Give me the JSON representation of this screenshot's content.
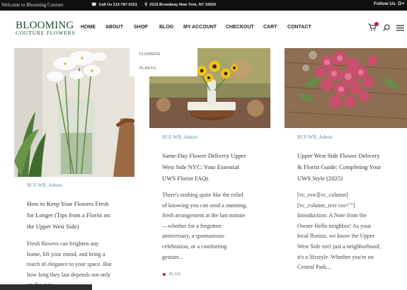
{
  "topbar": {
    "welcome": "Welcome to Blooming Couture",
    "phone": "Call Us 212-787-0151",
    "address": "2216 Broadway New York, NY 10024",
    "follow": "Follow Us",
    "social": "G+"
  },
  "logo": {
    "title": "BLOOMING",
    "subtitle": "COUTURE FLOWERS"
  },
  "nav": {
    "home": "HOME",
    "about": "ABOUT",
    "shop": "SHOP",
    "blog": "BLOG",
    "account": "MY ACCOUNT",
    "checkout": "CHECKOUT",
    "cart": "CART",
    "contact": "CONTACT"
  },
  "dropdown": {
    "item1": "FLOWERS",
    "item2": "PLANTS"
  },
  "posts": [
    {
      "author": "BCF-WB_Admin",
      "title_lines": [
        "How to Keep Your Flowers Fresh",
        "for Longer (Tips from a Florist on",
        "the Upper West Side)"
      ],
      "excerpt_lines": [
        "Fresh flowers can brighten any",
        "home, lift your mood, and bring a",
        "touch of elegance to your space. But",
        "how long they last depends not only",
        "on the care..."
      ]
    },
    {
      "author": "BCF-WB_Admin",
      "title_lines": [
        "Same-Day Flower Delivery Upper",
        "West Side NYC: Your Essential",
        "UWS Florist FAQs"
      ],
      "excerpt_lines": [
        "There's nothing quite like the relief",
        "of knowing you can send a stunning,",
        "fresh arrangement at the last minute",
        "—whether for a forgotten",
        "anniversary, a spontaneous",
        "celebration, or a comforting",
        "gesture..."
      ],
      "category": "BLOG"
    },
    {
      "author": "BCF-WB_Admin",
      "title_lines": [
        "Upper West Side Flower Delivery",
        "& Florist Guide: Completing Your",
        "UWS Style (2025)"
      ],
      "excerpt_lines": [
        "[vc_row][vc_column]",
        "[vc_column_text css=\"\"]",
        "Introduction: A Note from the",
        "Owner   Hello neighbor! As your",
        "local florists, we know the Upper",
        "West Side isn't just a neighborhood;",
        "it's a lifestyle. Whether you're on",
        "Central Park..."
      ]
    }
  ],
  "icons": {
    "phone": "phone-icon",
    "location": "location-pin-icon",
    "cart": "cart-icon",
    "search": "search-icon",
    "menu": "hamburger-menu-icon"
  },
  "colors": {
    "brand_green": "#1e4d2b",
    "accent_pink": "#c2185b",
    "author_blue": "#5a8fa8",
    "topbar": "#111111"
  }
}
